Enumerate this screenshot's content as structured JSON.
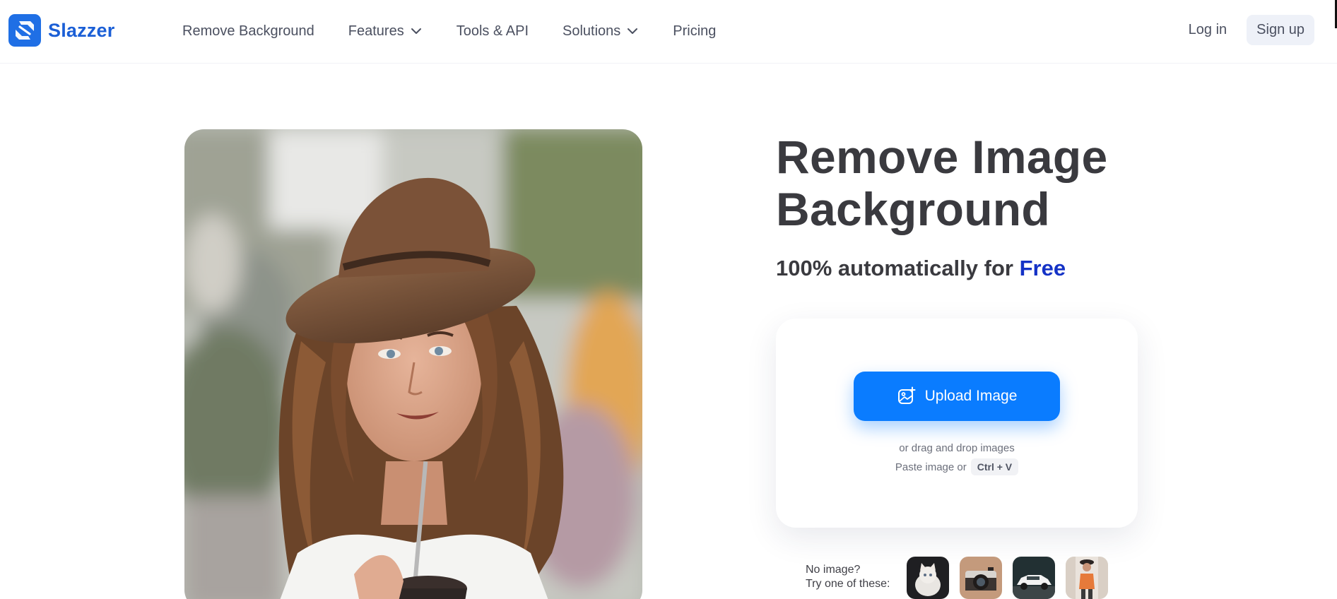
{
  "brand": {
    "name": "Slazzer",
    "color": "#1f6fe5"
  },
  "nav": {
    "items": [
      {
        "label": "Remove Background",
        "has_dropdown": false
      },
      {
        "label": "Features",
        "has_dropdown": true
      },
      {
        "label": "Tools & API",
        "has_dropdown": false
      },
      {
        "label": "Solutions",
        "has_dropdown": true
      },
      {
        "label": "Pricing",
        "has_dropdown": false
      }
    ]
  },
  "auth": {
    "login": "Log in",
    "signup": "Sign up"
  },
  "hero": {
    "title_line1": "Remove Image",
    "title_line2": "Background",
    "subtitle_prefix": "100% automatically for",
    "subtitle_highlight": "Free",
    "highlight_color": "#1432c6"
  },
  "upload": {
    "button_label": "Upload Image",
    "button_icon": "image-plus-icon",
    "drag_text": "or drag and drop images",
    "paste_text": "Paste image or",
    "shortcut": "Ctrl + V",
    "accent": "#0a7cff"
  },
  "samples": {
    "line1": "No image?",
    "line2": "Try one of these:",
    "items": [
      "kitten",
      "camera",
      "car",
      "person"
    ]
  }
}
